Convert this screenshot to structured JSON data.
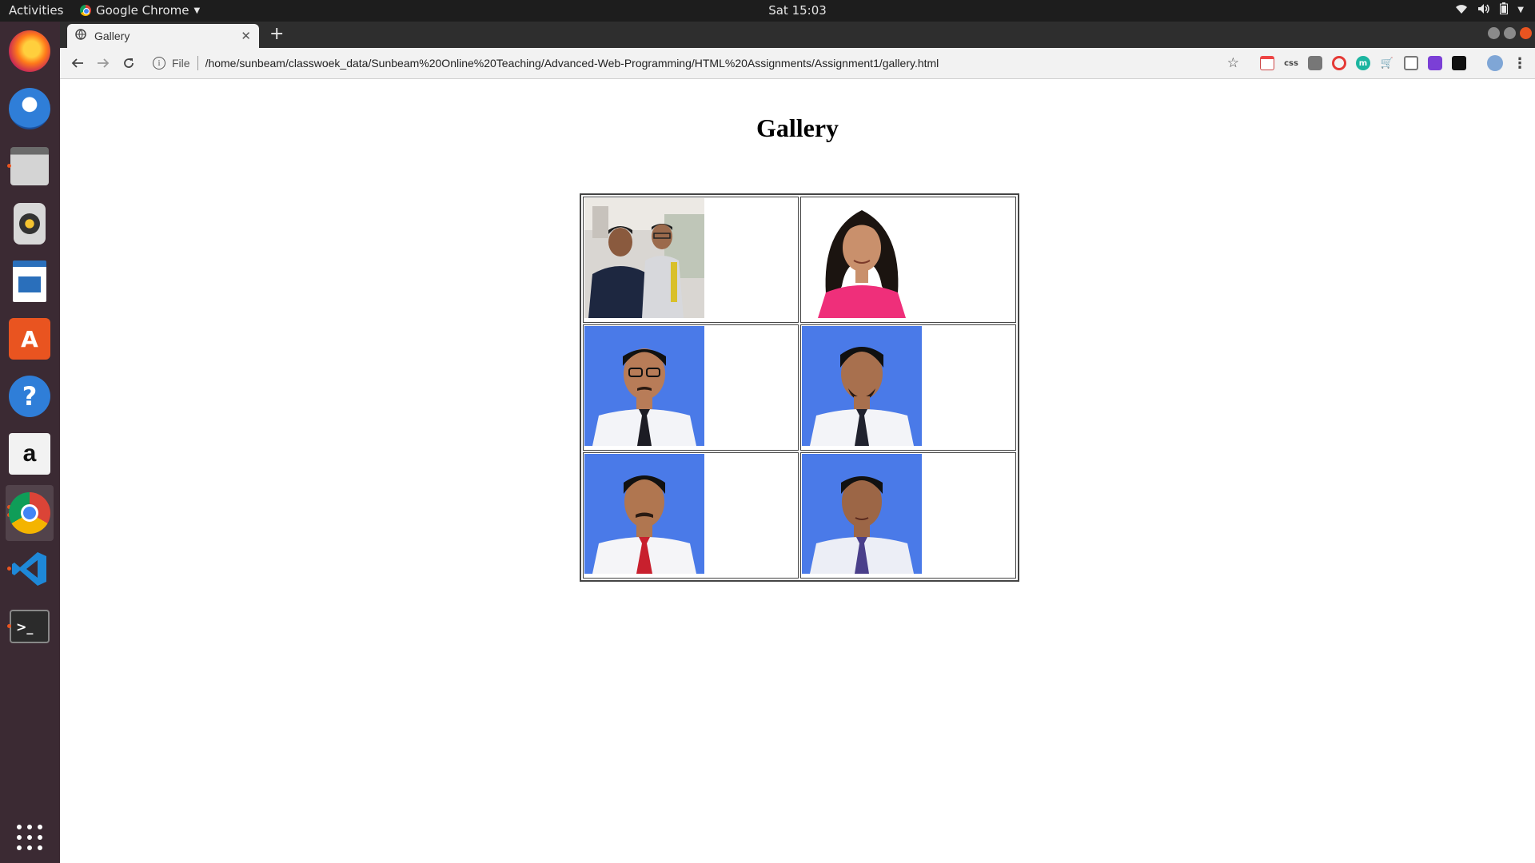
{
  "system": {
    "activities": "Activities",
    "app_name": "Google Chrome",
    "clock": "Sat 15:03"
  },
  "browser": {
    "tab_title": "Gallery",
    "scheme_label": "File",
    "url": "/home/sunbeam/classwoek_data/Sunbeam%20Online%20Teaching/Advanced-Web-Programming/HTML%20Assignments/Assignment1/gallery.html"
  },
  "page": {
    "heading": "Gallery"
  },
  "gallery": {
    "photos": [
      {
        "subject": "two-people-selfie"
      },
      {
        "subject": "woman-pink-top"
      },
      {
        "subject": "man-glasses-black-tie"
      },
      {
        "subject": "man-black-tie"
      },
      {
        "subject": "man-red-tie"
      },
      {
        "subject": "man-purple-tie"
      }
    ]
  },
  "icons": {
    "dock": [
      "firefox-icon",
      "thunderbird-icon",
      "files-icon",
      "rhythmbox-icon",
      "libreoffice-writer-icon",
      "software-center-icon",
      "help-icon",
      "amazon-icon",
      "chrome-icon",
      "vscode-icon",
      "terminal-icon",
      "app-grid-icon"
    ]
  },
  "colors": {
    "photo_background": "#4a7ae8",
    "dock_background": "#3b2a33",
    "accent": "#e95420"
  }
}
